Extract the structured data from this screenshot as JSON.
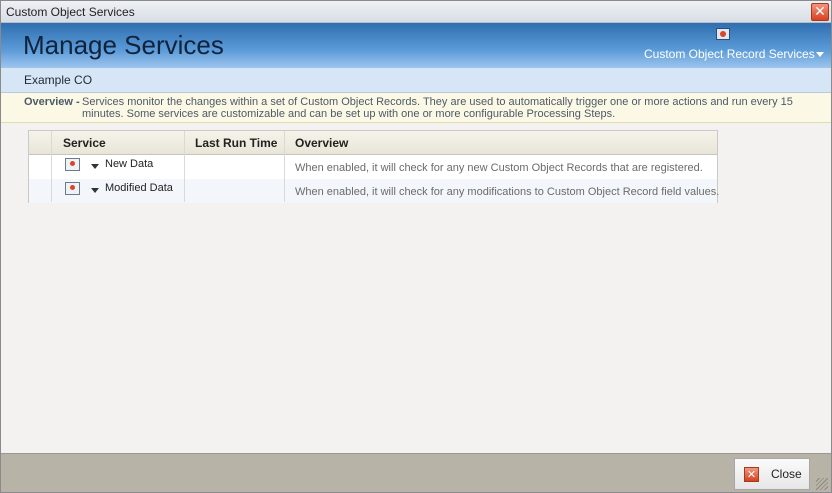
{
  "window": {
    "title": "Custom Object Services",
    "close_glyph": "✕"
  },
  "header": {
    "heading": "Manage Services",
    "menu_label": "Custom Object Record Services",
    "menu_icon": "service-icon"
  },
  "breadcrumb": "Example CO",
  "overview": {
    "label": "Overview -",
    "text": "Services monitor the changes within a set of Custom Object Records. They are used to automatically trigger one or more actions and run every 15 minutes. Some services are customizable and can be set up with one or more configurable Processing Steps."
  },
  "grid": {
    "columns": [
      "Service",
      "Last Run Time",
      "Overview"
    ],
    "rows": [
      {
        "service": "New Data",
        "last_run": "",
        "overview": "When enabled, it will check for any new Custom Object Records that are registered."
      },
      {
        "service": "Modified Data",
        "last_run": "",
        "overview": "When enabled, it will check for any modifications to Custom Object Record field values."
      }
    ]
  },
  "footer": {
    "close_label": "Close",
    "close_glyph": "✕"
  }
}
